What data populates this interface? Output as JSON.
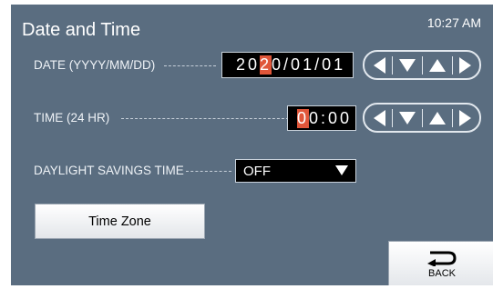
{
  "header": {
    "title": "Date and Time",
    "clock": "10:27 AM"
  },
  "date_row": {
    "label": "DATE (YYYY/MM/DD) ",
    "value_pre": "20",
    "value_cursor": "2",
    "value_post": "0/01/01"
  },
  "time_row": {
    "label": "TIME (24 HR) ",
    "value_cursor": "0",
    "value_post": "0:00"
  },
  "dst_row": {
    "label": "DAYLIGHT SAVINGS TIME",
    "selected": "OFF"
  },
  "buttons": {
    "time_zone": "Time Zone",
    "back": "BACK"
  },
  "colors": {
    "background": "#5a6d80",
    "cursor_highlight": "#e0563a",
    "field": "#000000"
  },
  "icons": [
    "arrow-left-icon",
    "arrow-down-icon",
    "arrow-up-icon",
    "arrow-right-icon",
    "back-return-icon",
    "dropdown-triangle-icon"
  ]
}
